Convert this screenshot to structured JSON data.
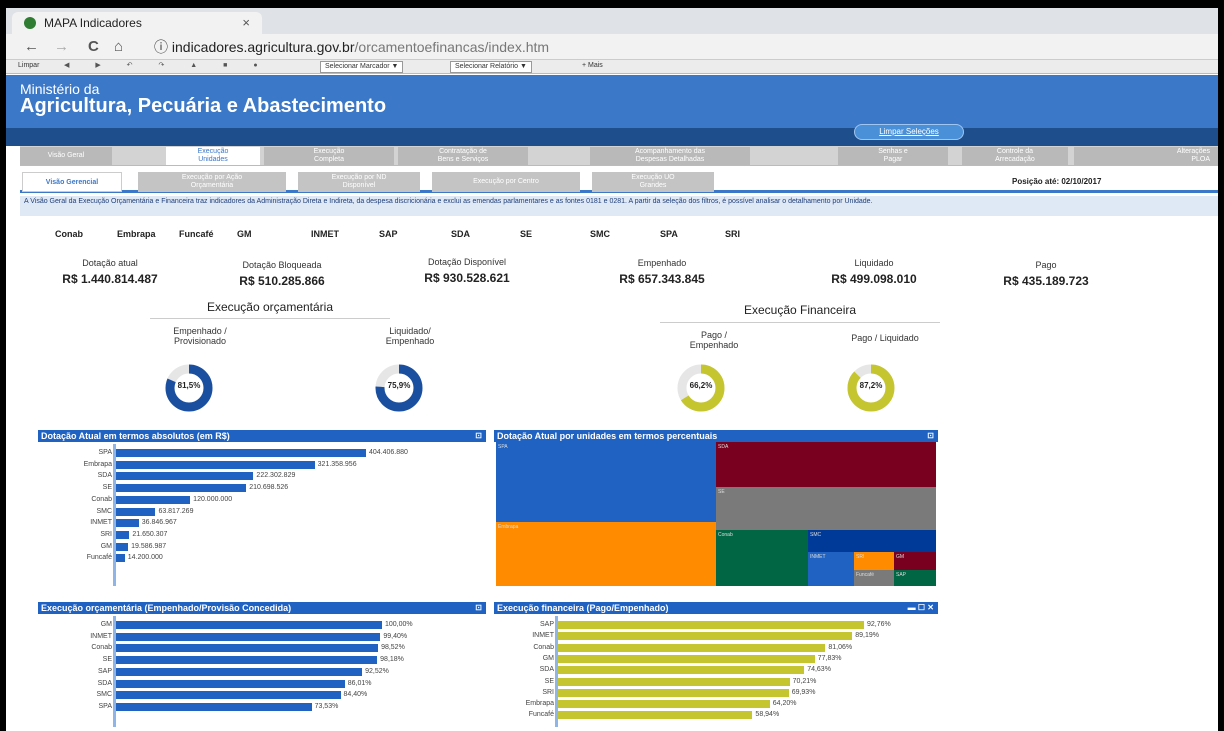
{
  "browser": {
    "tab_title": "MAPA Indicadores",
    "tab_close": "×",
    "nav_back": "←",
    "nav_forward": "→",
    "nav_reload": "C",
    "nav_home": "⌂",
    "info_icon": "ⓘ",
    "url_host": "indicadores.agricultura.gov.br",
    "url_path": "/orcamentoefinancas/index.htm",
    "bookmarks": {
      "limpar": "Limpar",
      "marcador": "Selecionar Marcador ▼",
      "relatorio": "Selecionar Relatório ▼",
      "mais": "+ Mais"
    }
  },
  "header": {
    "line1": "Ministério da",
    "line2": "Agricultura, Pecuária e Abastecimento",
    "clear_button": "Limpar Seleções"
  },
  "main_tabs": [
    {
      "label": "Visão Geral"
    },
    {
      "label": "Execução\nUnidades",
      "active": true
    },
    {
      "label": "Execução\nCompleta"
    },
    {
      "label": "Contratação de\nBens e Serviços"
    },
    {
      "label": "Acompanhamento das\nDespesas Detalhadas"
    },
    {
      "label": "Senhas e\nPagar"
    },
    {
      "label": "Controle da\nArrecadação"
    },
    {
      "label": "Alterações\nPLOA"
    }
  ],
  "sub_tabs": [
    {
      "label": "Visão Gerencial",
      "active": true
    },
    {
      "label": "Execução por Ação\nOrçamentária"
    },
    {
      "label": "Execução por ND\nDisponível"
    },
    {
      "label": "Execução por Centro"
    },
    {
      "label": "Execução UO\nGrandes"
    }
  ],
  "position_date": "Posição até: 02/10/2017",
  "description": "A Visão Geral da Execução Orçamentária e Financeira traz indicadores da Administração Direta e Indireta, da despesa discricionária e exclui as emendas parlamentares e as fontes 0181 e 0281. A partir da seleção dos filtros, é possível analisar o detalhamento por Unidade.",
  "units": [
    "Conab",
    "Embrapa",
    "Funcafé",
    "GM",
    "INMET",
    "SAP",
    "SDA",
    "SE",
    "SMC",
    "SPA",
    "SRI"
  ],
  "metrics": [
    {
      "label": "Dotação atual",
      "value": "R$ 1.440.814.487"
    },
    {
      "label": "Dotação Bloqueada",
      "value": "R$ 510.285.866"
    },
    {
      "label": "Dotação Disponível",
      "value": "R$ 930.528.621"
    },
    {
      "label": "Empenhado",
      "value": "R$ 657.343.845"
    },
    {
      "label": "Liquidado",
      "value": "R$ 499.098.010"
    },
    {
      "label": "Pago",
      "value": "R$ 435.189.723"
    }
  ],
  "sections": {
    "orcamentaria": "Execução orçamentária",
    "financeira": "Execução Financeira"
  },
  "gauges": [
    {
      "label": "Empenhado /\nProvisionado",
      "text": "81,5%",
      "value": 81.5,
      "color": "#1a4fa0"
    },
    {
      "label": "Liquidado/\nEmpenhado",
      "text": "75,9%",
      "value": 75.9,
      "color": "#1a4fa0"
    },
    {
      "label": "Pago /\nEmpenhado",
      "text": "66,2%",
      "value": 66.2,
      "color": "#c5c530"
    },
    {
      "label": "Pago / Liquidado",
      "text": "87,2%",
      "value": 87.2,
      "color": "#c5c530"
    }
  ],
  "chart_data": [
    {
      "type": "bar",
      "title": "Dotação Atual em termos absolutos (em R$)",
      "categories": [
        "SPA",
        "Embrapa",
        "SDA",
        "SE",
        "Conab",
        "SMC",
        "INMET",
        "SRI",
        "GM",
        "Funcafé"
      ],
      "values": [
        404406880,
        321358956,
        222302829,
        210698526,
        120000000,
        63817269,
        36846967,
        21650307,
        19586987,
        14200000
      ],
      "labels": [
        "404.406.880",
        "321.358.956",
        "222.302.829",
        "210.698.526",
        "120.000.000",
        "63.817.269",
        "36.846.967",
        "21.650.307",
        "19.586.987",
        "14.200.000"
      ],
      "color": "#1f62c2"
    },
    {
      "type": "heatmap",
      "title": "Dotação Atual por unidades em termos percentuais",
      "cells": [
        {
          "name": "SPA",
          "color": "#1f62c2"
        },
        {
          "name": "Embrapa",
          "color": "#ff8c00"
        },
        {
          "name": "SDA",
          "color": "#7a0020"
        },
        {
          "name": "SE",
          "color": "#7a7a7a"
        },
        {
          "name": "Conab",
          "color": "#006644"
        },
        {
          "name": "SMC",
          "color": "#003a99"
        },
        {
          "name": "INMET",
          "color": "#1f62c2"
        },
        {
          "name": "SRI",
          "color": "#ff8c00"
        },
        {
          "name": "GM",
          "color": "#7a0020"
        },
        {
          "name": "Funcafé",
          "color": "#7a7a7a"
        },
        {
          "name": "SAP",
          "color": "#006644"
        }
      ]
    },
    {
      "type": "bar",
      "title": "Execução orçamentária (Empenhado/Provisão Concedida)",
      "categories": [
        "GM",
        "INMET",
        "Conab",
        "SE",
        "SAP",
        "SDA",
        "SMC",
        "SPA"
      ],
      "values": [
        100.0,
        99.4,
        98.52,
        98.18,
        92.52,
        86.01,
        84.4,
        73.53
      ],
      "labels": [
        "100,00%",
        "99,40%",
        "98,52%",
        "98,18%",
        "92,52%",
        "86,01%",
        "84,40%",
        "73,53%"
      ],
      "color": "#1f62c2"
    },
    {
      "type": "bar",
      "title": "Execução financeira (Pago/Empenhado)",
      "categories": [
        "SAP",
        "INMET",
        "Conab",
        "GM",
        "SDA",
        "SE",
        "SRI",
        "Embrapa",
        "Funcafé"
      ],
      "values": [
        92.76,
        89.19,
        81.06,
        77.83,
        74.63,
        70.21,
        69.93,
        64.2,
        58.94
      ],
      "labels": [
        "92,76%",
        "89,19%",
        "81,06%",
        "77,83%",
        "74,63%",
        "70,21%",
        "69,93%",
        "64,20%",
        "58,94%"
      ],
      "color": "#c5c530"
    }
  ]
}
